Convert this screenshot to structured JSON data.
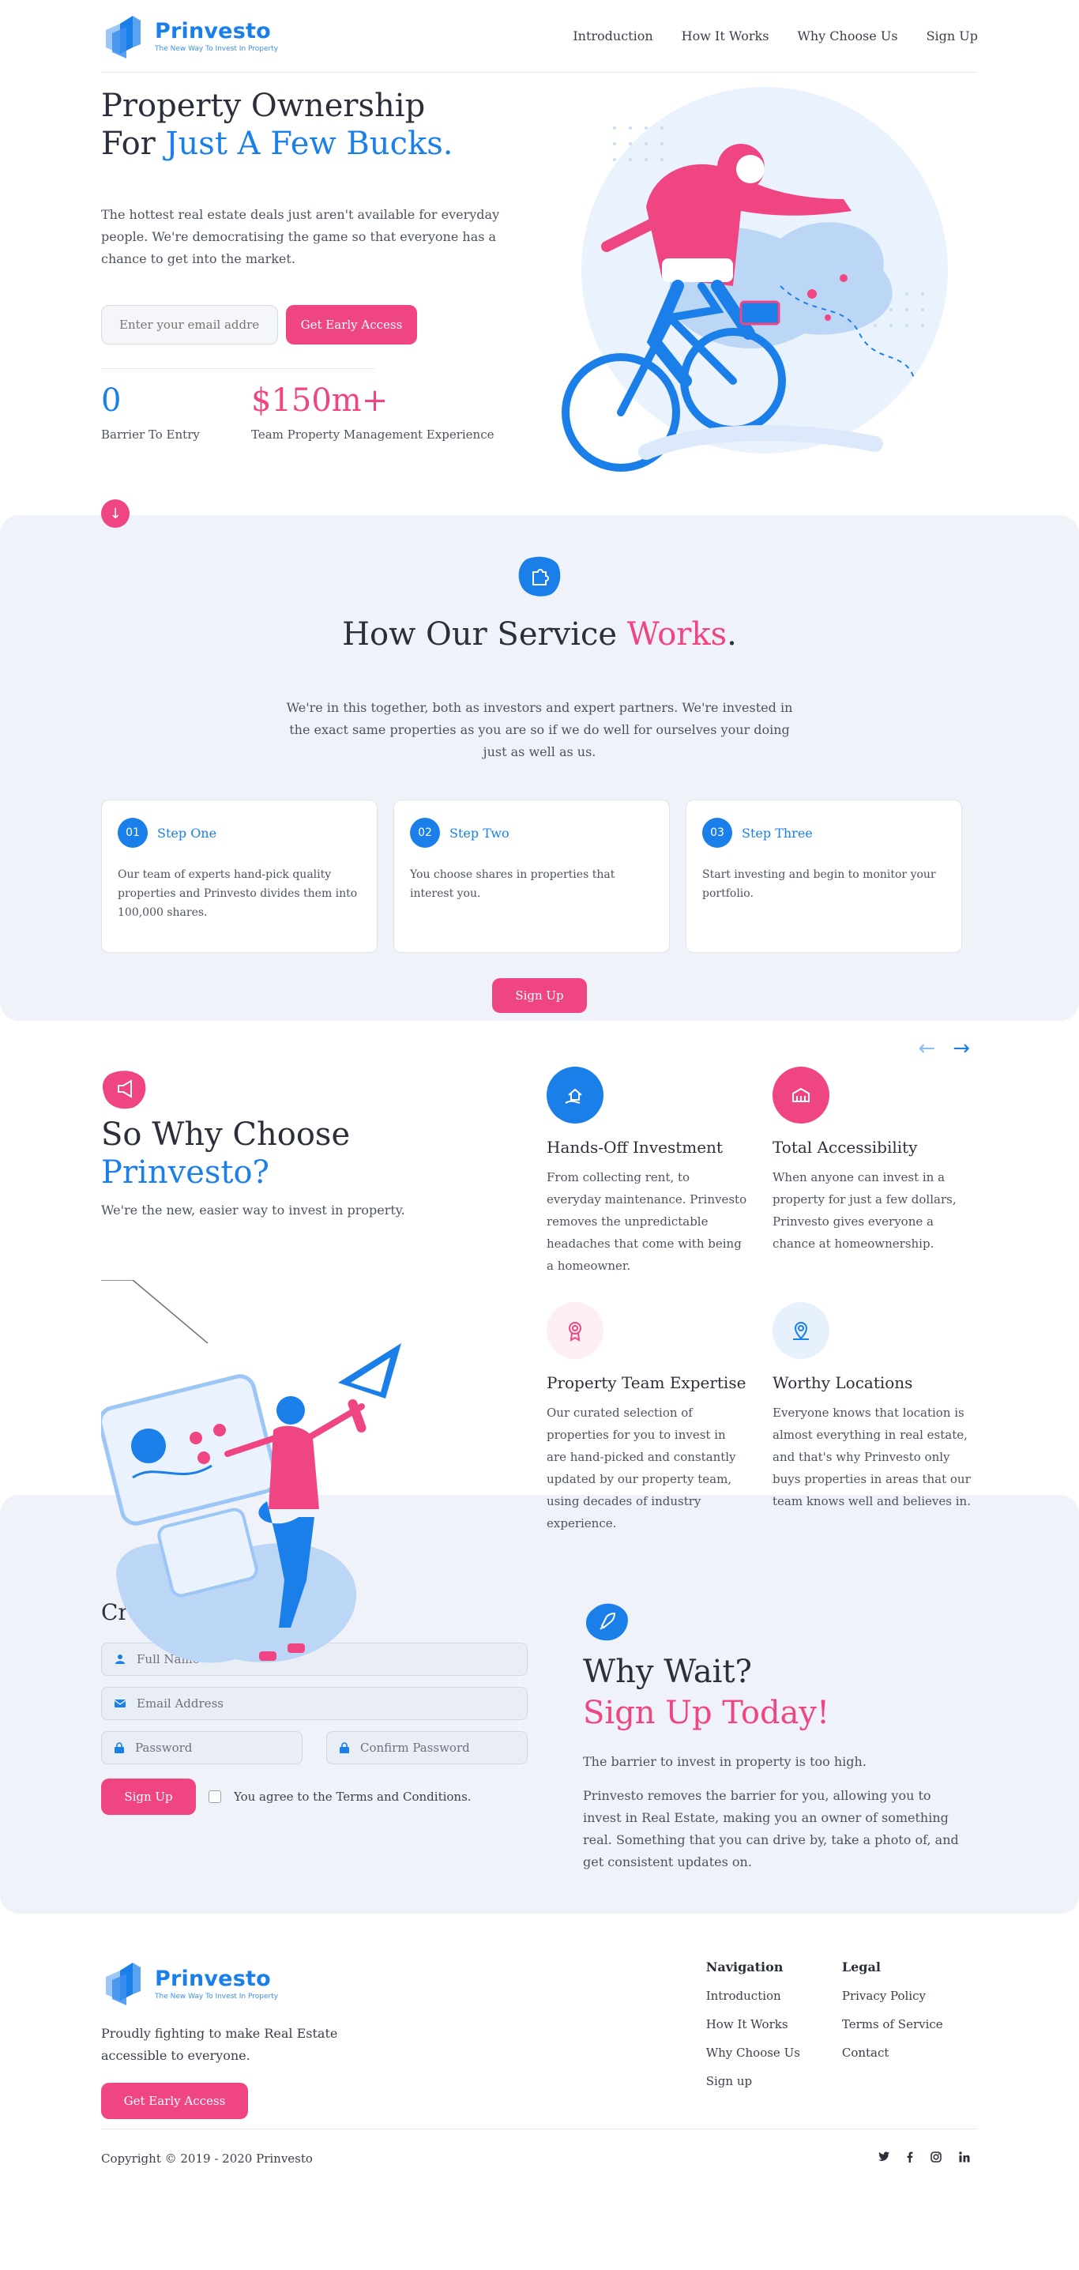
{
  "brand": {
    "name": "Prinvesto",
    "tagline": "The New Way To Invest In Property"
  },
  "nav": {
    "items": [
      "Introduction",
      "How It Works",
      "Why Choose Us",
      "Sign Up"
    ]
  },
  "hero": {
    "title_line1": "Property Ownership",
    "title_prefix": "For",
    "title_accent": "Just A Few Bucks.",
    "description": "The hottest real estate deals just aren't available for everyday people. We're democratising the game so that everyone has a chance to get into the market.",
    "email_placeholder": "Enter your email address",
    "cta": "Get Early Access",
    "stats": [
      {
        "value": "0",
        "label": "Barrier To Entry"
      },
      {
        "value": "$150m+",
        "label": "Team Property Management Experience"
      }
    ]
  },
  "how": {
    "title": "How Our Service",
    "title_accent": "Works",
    "title_end": ".",
    "description": "We're in this together, both as investors and expert partners. We're invested in the exact same properties as you are so if we do well for ourselves your doing just as well as us.",
    "steps": [
      {
        "num": "01",
        "title": "Step One",
        "text": "Our team of experts hand-pick quality properties and Prinvesto divides them into 100,000 shares."
      },
      {
        "num": "02",
        "title": "Step Two",
        "text": "You choose shares in properties that interest you."
      },
      {
        "num": "03",
        "title": "Step Three",
        "text": "Start investing and begin to monitor your portfolio."
      }
    ],
    "cta": "Sign Up",
    "prev_arrow": "←",
    "next_arrow": "→"
  },
  "why": {
    "title_line1": "So Why Choose",
    "title_accent": "Prinvesto?",
    "subtitle": "We're the new, easier way to invest in property.",
    "features": [
      {
        "title": "Hands-Off Investment",
        "text": "From collecting rent, to everyday maintenance. Prinvesto removes the unpredictable headaches that come with being a homeowner.",
        "icon": "hand-house-icon",
        "color": "#1a7fe8"
      },
      {
        "title": "Total Accessibility",
        "text": "When anyone can invest in a property for just a few dollars, Prinvesto gives everyone a chance at homeownership.",
        "icon": "building-icon",
        "color": "#f04583"
      },
      {
        "title": "Property Team Expertise",
        "text": "Our curated selection of properties for you to invest in are hand-picked and constantly updated by our property team, using decades of industry experience.",
        "icon": "award-icon",
        "color": "#fdeef3"
      },
      {
        "title": "Worthy Locations",
        "text": "Everyone knows that location is almost everything in real estate, and that's why Prinvesto only buys properties in areas that our team knows well and believes in.",
        "icon": "map-pin-icon",
        "color": "#e6f1fd"
      }
    ]
  },
  "account": {
    "title": "Create An Account",
    "full_name": "Full Name",
    "email": "Email Address",
    "password": "Password",
    "confirm_password": "Confirm Password",
    "cta": "Sign Up",
    "agree": "You agree to the Terms and Conditions."
  },
  "wait": {
    "title": "Why Wait?",
    "title_accent": "Sign Up Today!",
    "p1": "The barrier to invest in property is too high.",
    "p2": "Prinvesto removes the barrier for you, allowing you to invest in Real Estate, making you an owner of something real. Something that you can drive by, take a photo of, and get consistent updates on."
  },
  "footer": {
    "about": "Proudly fighting to make Real Estate accessible to everyone.",
    "cta": "Get Early Access",
    "nav_title": "Navigation",
    "nav_links": [
      "Introduction",
      "How It Works",
      "Why Choose Us",
      "Sign up"
    ],
    "legal_title": "Legal",
    "legal_links": [
      "Privacy Policy",
      "Terms of Service",
      "Contact"
    ],
    "copyright": "Copyright © 2019 - 2020 Prinvesto",
    "socials": [
      "twitter",
      "facebook",
      "instagram",
      "linkedin"
    ]
  },
  "colors": {
    "primary": "#1a7fe8",
    "accent": "#f04583",
    "section_bg": "#eff2f8"
  }
}
